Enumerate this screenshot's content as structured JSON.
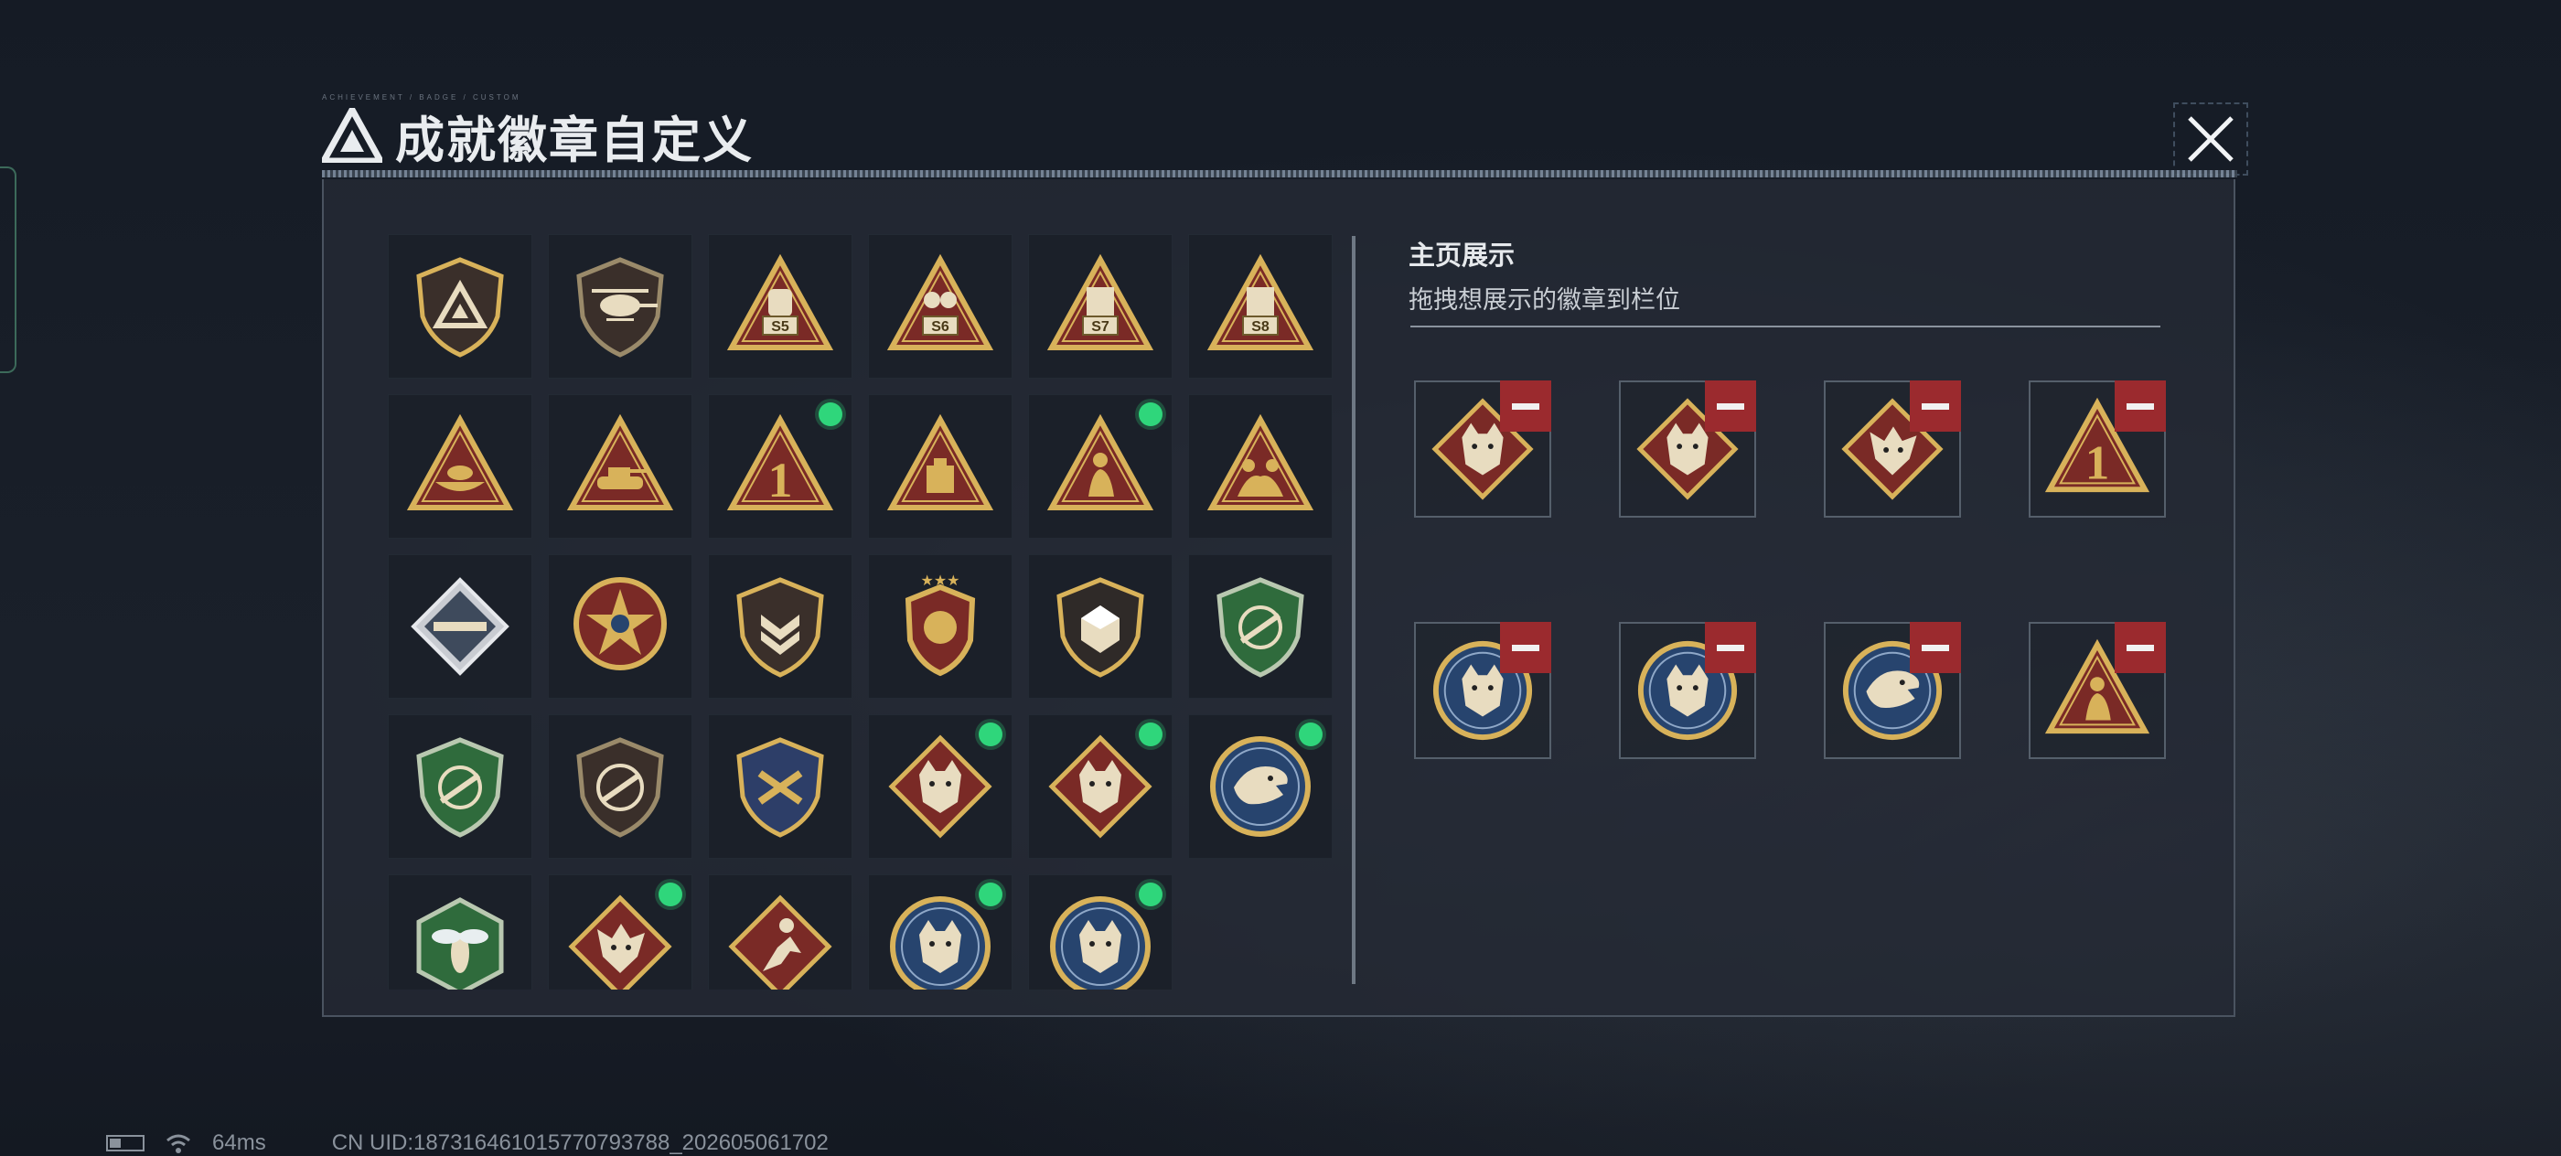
{
  "window": {
    "title": "成就徽章自定义",
    "micro_caption": "ACHIEVEMENT / BADGE / CUSTOM"
  },
  "right_panel": {
    "title": "主页展示",
    "subtitle": "拖拽想展示的徽章到栏位"
  },
  "badges": [
    {
      "icon": "shield-delta-badge-icon",
      "new": false
    },
    {
      "icon": "helicopter-badge-icon",
      "new": false
    },
    {
      "icon": "s5-backpack-badge-icon",
      "new": false
    },
    {
      "icon": "s6-armor-badge-icon",
      "new": false
    },
    {
      "icon": "s7-crate-badge-icon",
      "new": false
    },
    {
      "icon": "s8-crate-badge-icon",
      "new": false
    },
    {
      "icon": "boat-badge-icon",
      "new": false
    },
    {
      "icon": "tank-badge-icon",
      "new": false
    },
    {
      "icon": "number-one-badge-icon",
      "new": true
    },
    {
      "icon": "crate-triangle-badge-icon",
      "new": false
    },
    {
      "icon": "kneeling-soldier-badge-icon",
      "new": true
    },
    {
      "icon": "squad-badge-icon",
      "new": false
    },
    {
      "icon": "launcher-diamond-badge-icon",
      "new": false
    },
    {
      "icon": "star-medal-badge-icon",
      "new": false
    },
    {
      "icon": "chevron-shield-badge-icon",
      "new": false
    },
    {
      "icon": "winged-crest-badge-icon",
      "new": false
    },
    {
      "icon": "dice-shield-badge-icon",
      "new": false
    },
    {
      "icon": "green-rifle-laurel-badge-icon",
      "new": false
    },
    {
      "icon": "green-rifle-shield-badge-icon",
      "new": false
    },
    {
      "icon": "rifle-shield-badge-icon",
      "new": false
    },
    {
      "icon": "gold-crossed-weapons-badge-icon",
      "new": false
    },
    {
      "icon": "wolf-diamond-badge-icon",
      "new": true
    },
    {
      "icon": "wolf-diamond-badge-icon",
      "new": true
    },
    {
      "icon": "eagle-circle-badge-icon",
      "new": true
    },
    {
      "icon": "wasp-hexagon-badge-icon",
      "new": false
    },
    {
      "icon": "dragon-diamond-badge-icon",
      "new": true
    },
    {
      "icon": "runner-diamond-badge-icon",
      "new": false
    },
    {
      "icon": "lynx-circle-badge-icon",
      "new": true
    },
    {
      "icon": "lynx-circle-badge-icon",
      "new": true
    }
  ],
  "slots": [
    {
      "icon": "wolf-diamond-badge-icon"
    },
    {
      "icon": "wolf-diamond-badge-icon"
    },
    {
      "icon": "dragon-diamond-badge-icon"
    },
    {
      "icon": "number-one-badge-icon"
    },
    {
      "icon": "lynx-circle-badge-icon"
    },
    {
      "icon": "lynx-circle-badge-icon"
    },
    {
      "icon": "eagle-circle-badge-icon"
    },
    {
      "icon": "kneeling-soldier-badge-icon"
    }
  ],
  "status_bar": {
    "ping": "64ms",
    "uid": "CN UID:18731646101577079378​8_202605061702"
  },
  "colors": {
    "new_dot": "#2fd67b",
    "remove": "#9b2a2e",
    "badge_gold": "#d8b25a",
    "badge_red": "#7a2a26"
  }
}
